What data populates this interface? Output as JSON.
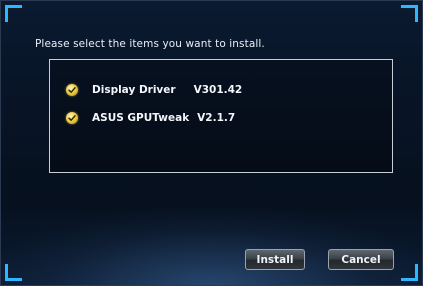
{
  "dialog": {
    "prompt": "Please select the items you want to install."
  },
  "items": [
    {
      "name": "Display Driver",
      "version": "V301.42",
      "checked": true
    },
    {
      "name": "ASUS GPUTweak",
      "version": "V2.1.7",
      "checked": true
    }
  ],
  "buttons": {
    "install_label": "Install",
    "cancel_label": "Cancel"
  },
  "colors": {
    "accent": "#2fb6ff",
    "check": "#e8c33a",
    "background": "#081426"
  },
  "icons": {
    "checkbox": "checkmark-icon"
  }
}
